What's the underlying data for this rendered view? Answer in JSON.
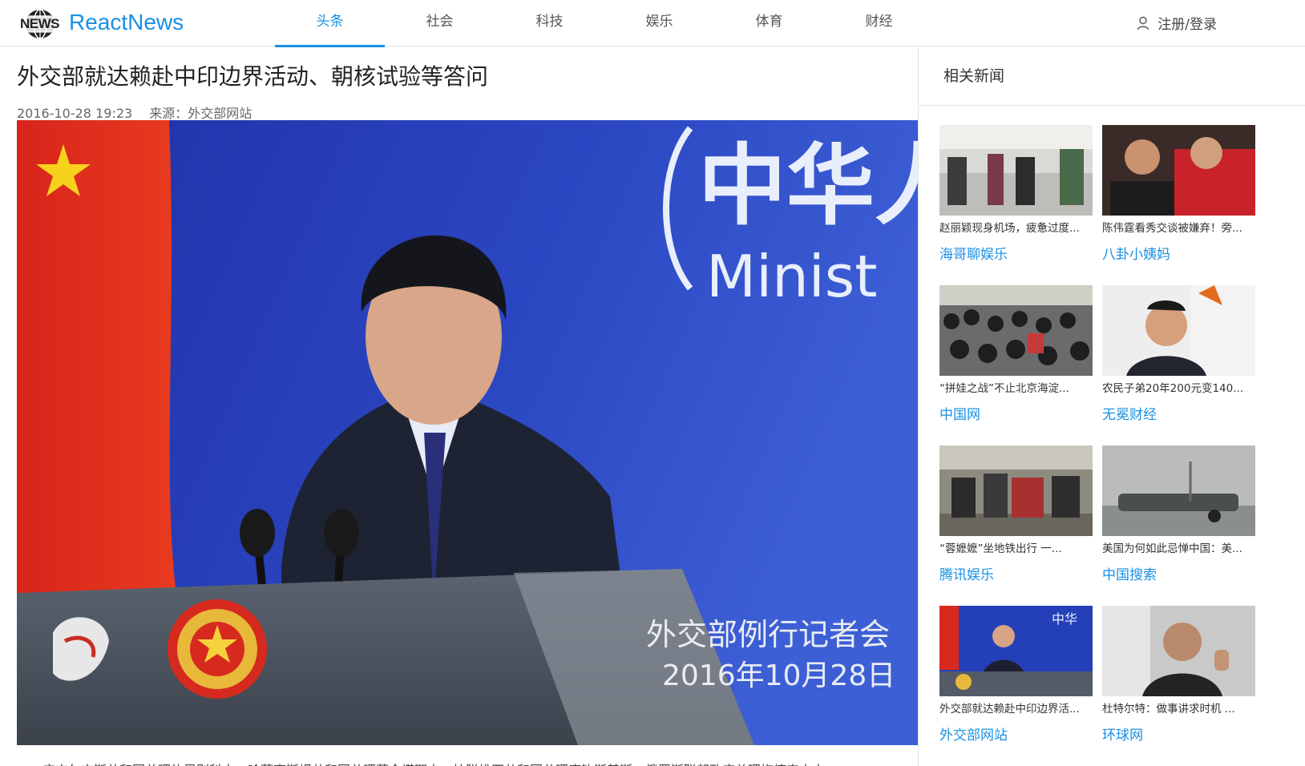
{
  "header": {
    "logo_badge": "NEWS",
    "logo_text": "ReactNews",
    "tabs": [
      {
        "label": "头条",
        "active": true
      },
      {
        "label": "社会",
        "active": false
      },
      {
        "label": "科技",
        "active": false
      },
      {
        "label": "娱乐",
        "active": false
      },
      {
        "label": "体育",
        "active": false
      },
      {
        "label": "财经",
        "active": false
      }
    ],
    "user_label": "注册/登录"
  },
  "article": {
    "title": "外交部就达赖赴中印边界活动、朝核试验等答问",
    "date": "2016-10-28 19:23",
    "source": "来源：外交部网站",
    "hero_backdrop_text": "中华人",
    "hero_backdrop_en": "Minist",
    "hero_caption_line1": "外交部例行记者会",
    "hero_caption_line2": "2016年10月28日",
    "body_first_line": "一、应吉尔吉斯共和国总理热恩别科夫、哈萨克斯坦共和国总理萨金塔耶夫、拉脱维亚共和国总理库钦斯基斯、俄罗斯联邦政府总理梅德韦杰夫"
  },
  "sidebar": {
    "heading": "相关新闻",
    "items": [
      {
        "title": "赵丽颖现身机场，疲惫过度...",
        "source": "海哥聊娱乐",
        "icon": "airport-photo"
      },
      {
        "title": "陈伟霆看秀交谈被嫌弃！旁...",
        "source": "八卦小姨妈",
        "icon": "show-photo"
      },
      {
        "title": "“拼娃之战”不止北京海淀...",
        "source": "中国网",
        "icon": "crowd-photo"
      },
      {
        "title": "农民子弟20年200元变140...",
        "source": "无冕财经",
        "icon": "portrait-photo"
      },
      {
        "title": "“蓉嬷嬷”坐地铁出行 一...",
        "source": "腾讯娱乐",
        "icon": "subway-photo"
      },
      {
        "title": "美国为何如此忌惮中国：美...",
        "source": "中国搜索",
        "icon": "missile-photo"
      },
      {
        "title": "外交部就达赖赴中印边界活...",
        "source": "外交部网站",
        "icon": "press-photo"
      },
      {
        "title": "杜特尔特：做事讲求时机 ...",
        "source": "环球网",
        "icon": "speaker-photo"
      }
    ]
  },
  "colors": {
    "accent": "#1a8fe3",
    "border": "#e5e5e5"
  }
}
